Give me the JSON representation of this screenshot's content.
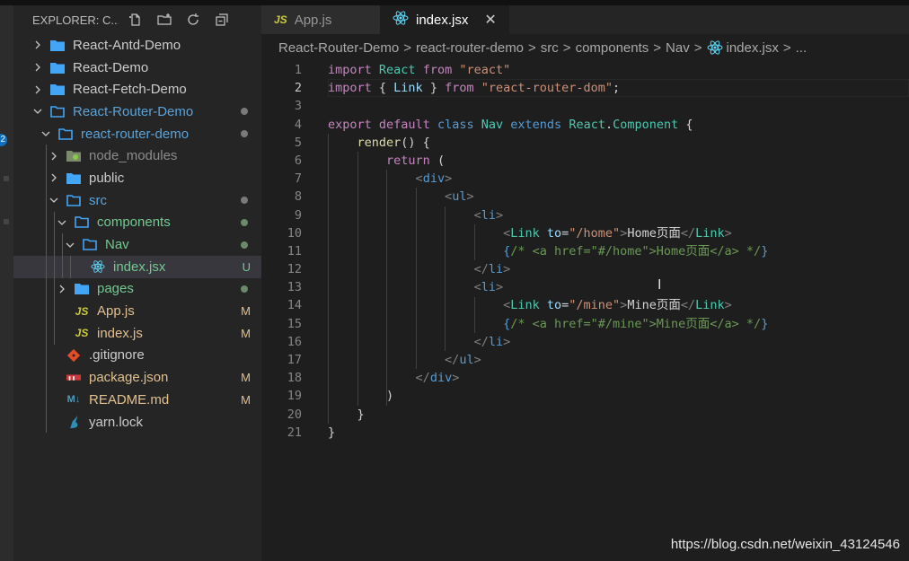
{
  "explorer": {
    "title": "EXPLORER: C...",
    "actions": [
      {
        "name": "new-file-icon",
        "glyph": "new-file"
      },
      {
        "name": "new-folder-icon",
        "glyph": "new-folder"
      },
      {
        "name": "refresh-icon",
        "glyph": "refresh"
      },
      {
        "name": "collapse-all-icon",
        "glyph": "collapse"
      }
    ],
    "activity_badge": "2",
    "tree": [
      {
        "label": "React-Antd-Demo",
        "depth": 0,
        "kind": "folder",
        "open": false
      },
      {
        "label": "React-Demo",
        "depth": 0,
        "kind": "folder",
        "open": false
      },
      {
        "label": "React-Fetch-Demo",
        "depth": 0,
        "kind": "folder",
        "open": false
      },
      {
        "label": "React-Router-Demo",
        "depth": 0,
        "kind": "folder",
        "open": true,
        "status": "dot",
        "color": "#5aa3d8"
      },
      {
        "label": "react-router-demo",
        "depth": 1,
        "kind": "folder",
        "open": true,
        "status": "dot",
        "color": "#5aa3d8"
      },
      {
        "label": "node_modules",
        "depth": 2,
        "kind": "node",
        "open": false,
        "color": "#8b8b8b"
      },
      {
        "label": "public",
        "depth": 2,
        "kind": "folder",
        "open": false
      },
      {
        "label": "src",
        "depth": 2,
        "kind": "folder",
        "open": true,
        "status": "dot",
        "color": "#5aa3d8"
      },
      {
        "label": "components",
        "depth": 3,
        "kind": "folder",
        "open": true,
        "status": "dot-green",
        "color": "#73c991"
      },
      {
        "label": "Nav",
        "depth": 4,
        "kind": "folder",
        "open": true,
        "status": "dot-green",
        "color": "#73c991"
      },
      {
        "label": "index.jsx",
        "depth": 5,
        "kind": "react",
        "status": "U",
        "color": "#73c991",
        "selected": true
      },
      {
        "label": "pages",
        "depth": 3,
        "kind": "folder",
        "open": false,
        "status": "dot-green",
        "color": "#73c991"
      },
      {
        "label": "App.js",
        "depth": 3,
        "kind": "js",
        "status": "M",
        "color": "#e2c08d"
      },
      {
        "label": "index.js",
        "depth": 3,
        "kind": "js",
        "status": "M",
        "color": "#e2c08d"
      },
      {
        "label": ".gitignore",
        "depth": 2,
        "kind": "git"
      },
      {
        "label": "package.json",
        "depth": 2,
        "kind": "npm",
        "status": "M",
        "color": "#e2c08d"
      },
      {
        "label": "README.md",
        "depth": 2,
        "kind": "md",
        "status": "M",
        "color": "#e2c08d"
      },
      {
        "label": "yarn.lock",
        "depth": 2,
        "kind": "yarn"
      }
    ]
  },
  "tabs": [
    {
      "label": "App.js",
      "icon": "JS",
      "active": false
    },
    {
      "label": "index.jsx",
      "icon": "react",
      "active": true,
      "close": "✕"
    }
  ],
  "breadcrumb": [
    "React-Router-Demo",
    "react-router-demo",
    "src",
    "components",
    "Nav",
    "index.jsx",
    "..."
  ],
  "breadcrumb_sep": ">",
  "code": {
    "current_line": 2,
    "lines": [
      [
        [
          "kw2",
          "import"
        ],
        [
          "t",
          " "
        ],
        [
          "cls",
          "React"
        ],
        [
          "t",
          " "
        ],
        [
          "kw2",
          "from"
        ],
        [
          "t",
          " "
        ],
        [
          "str",
          "\"react\""
        ]
      ],
      [
        [
          "kw2",
          "import"
        ],
        [
          "t",
          " { "
        ],
        [
          "var",
          "Link"
        ],
        [
          "t",
          " } "
        ],
        [
          "kw2",
          "from"
        ],
        [
          "t",
          " "
        ],
        [
          "str",
          "\"react-router-dom\""
        ],
        [
          "t",
          ";"
        ]
      ],
      [],
      [
        [
          "kw2",
          "export"
        ],
        [
          "t",
          " "
        ],
        [
          "kw2",
          "default"
        ],
        [
          "t",
          " "
        ],
        [
          "kw",
          "class"
        ],
        [
          "t",
          " "
        ],
        [
          "cls",
          "Nav"
        ],
        [
          "t",
          " "
        ],
        [
          "kw",
          "extends"
        ],
        [
          "t",
          " "
        ],
        [
          "cls",
          "React"
        ],
        [
          "t",
          "."
        ],
        [
          "cls",
          "Component"
        ],
        [
          "t",
          " {"
        ]
      ],
      [
        [
          "t",
          "    "
        ],
        [
          "fn",
          "render"
        ],
        [
          "t",
          "() {"
        ]
      ],
      [
        [
          "t",
          "        "
        ],
        [
          "kw2",
          "return"
        ],
        [
          "t",
          " ("
        ]
      ],
      [
        [
          "t",
          "            "
        ],
        [
          "brk",
          "<"
        ],
        [
          "tag",
          "div"
        ],
        [
          "brk",
          ">"
        ]
      ],
      [
        [
          "t",
          "                "
        ],
        [
          "brk",
          "<"
        ],
        [
          "tag",
          "ul"
        ],
        [
          "brk",
          ">"
        ]
      ],
      [
        [
          "t",
          "                    "
        ],
        [
          "brk",
          "<"
        ],
        [
          "tag",
          "li"
        ],
        [
          "brk",
          ">"
        ]
      ],
      [
        [
          "t",
          "                        "
        ],
        [
          "brk",
          "<"
        ],
        [
          "cls",
          "Link"
        ],
        [
          "t",
          " "
        ],
        [
          "attr",
          "to"
        ],
        [
          "t",
          "="
        ],
        [
          "str",
          "\"/home\""
        ],
        [
          "brk",
          ">"
        ],
        [
          "jsxtext",
          "Home页面"
        ],
        [
          "brk",
          "</"
        ],
        [
          "cls",
          "Link"
        ],
        [
          "brk",
          ">"
        ]
      ],
      [
        [
          "t",
          "                        "
        ],
        [
          "kw",
          "{"
        ],
        [
          "cmt",
          "/* <a href=\"#/home\">Home页面</a> */"
        ],
        [
          "kw",
          "}"
        ]
      ],
      [
        [
          "t",
          "                    "
        ],
        [
          "brk",
          "</"
        ],
        [
          "tag",
          "li"
        ],
        [
          "brk",
          ">"
        ]
      ],
      [
        [
          "t",
          "                    "
        ],
        [
          "brk",
          "<"
        ],
        [
          "tag",
          "li"
        ],
        [
          "brk",
          ">"
        ]
      ],
      [
        [
          "t",
          "                        "
        ],
        [
          "brk",
          "<"
        ],
        [
          "cls",
          "Link"
        ],
        [
          "t",
          " "
        ],
        [
          "attr",
          "to"
        ],
        [
          "t",
          "="
        ],
        [
          "str",
          "\"/mine\""
        ],
        [
          "brk",
          ">"
        ],
        [
          "jsxtext",
          "Mine页面"
        ],
        [
          "brk",
          "</"
        ],
        [
          "cls",
          "Link"
        ],
        [
          "brk",
          ">"
        ]
      ],
      [
        [
          "t",
          "                        "
        ],
        [
          "kw",
          "{"
        ],
        [
          "cmt",
          "/* <a href=\"#/mine\">Mine页面</a> */"
        ],
        [
          "kw",
          "}"
        ]
      ],
      [
        [
          "t",
          "                    "
        ],
        [
          "brk",
          "</"
        ],
        [
          "tag",
          "li"
        ],
        [
          "brk",
          ">"
        ]
      ],
      [
        [
          "t",
          "                "
        ],
        [
          "brk",
          "</"
        ],
        [
          "tag",
          "ul"
        ],
        [
          "brk",
          ">"
        ]
      ],
      [
        [
          "t",
          "            "
        ],
        [
          "brk",
          "</"
        ],
        [
          "tag",
          "div"
        ],
        [
          "brk",
          ">"
        ]
      ],
      [
        [
          "t",
          "        )"
        ]
      ],
      [
        [
          "t",
          "    }"
        ]
      ],
      [
        [
          "t",
          "}"
        ]
      ]
    ]
  },
  "watermark": "https://blog.csdn.net/weixin_43124546",
  "colors": {
    "folder": "#42a5f5",
    "react": "#61dafb",
    "js": "#cbcb41",
    "git": "#e44d26",
    "npm": "#cb3837",
    "md": "#519aba",
    "yarn": "#2c8ebb"
  }
}
